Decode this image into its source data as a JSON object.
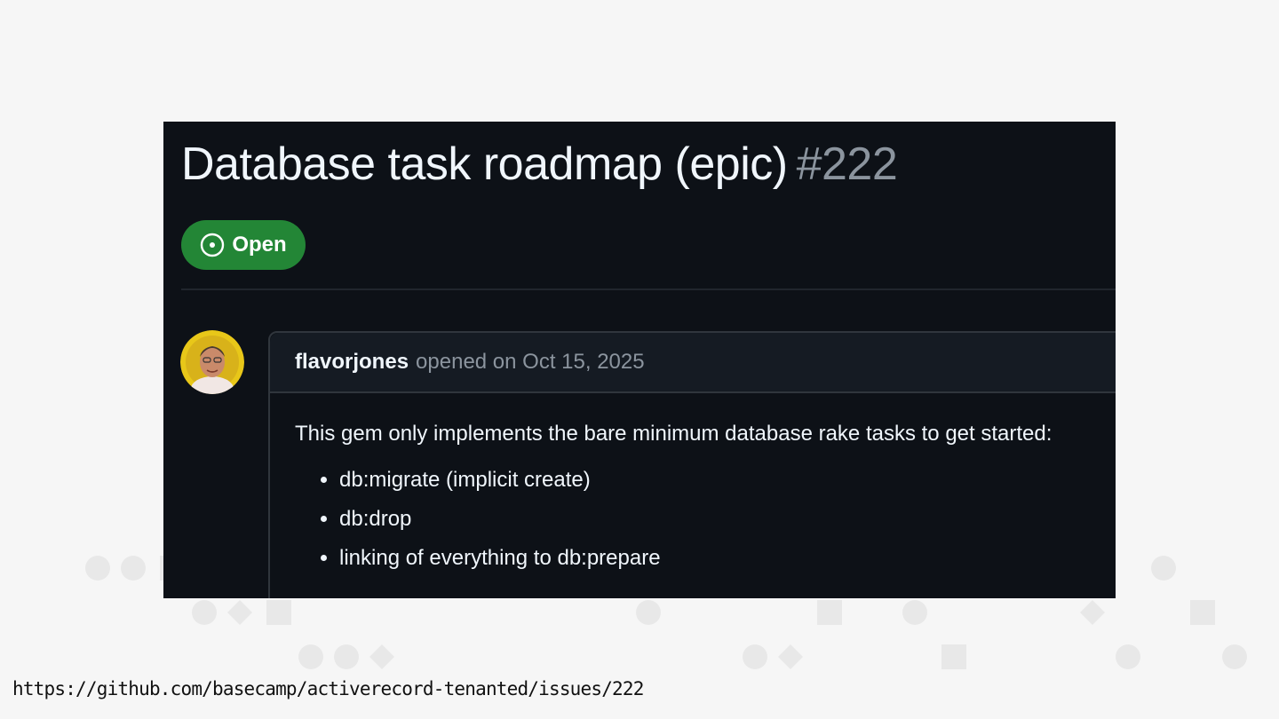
{
  "issue": {
    "title": "Database task roadmap (epic)",
    "number": "#222",
    "state_label": "Open",
    "state_icon": "issue-opened-icon",
    "state_color": "#238636"
  },
  "comment": {
    "author": "flavorjones",
    "meta": "opened on Oct 15, 2025",
    "intro": "This gem only implements the bare minimum database rake tasks to get started:",
    "items": [
      "db:migrate (implicit create)",
      "db:drop",
      "linking of everything to db:prepare"
    ]
  },
  "footer": {
    "url": "https://github.com/basecamp/activerecord-tenanted/issues/222"
  },
  "colors": {
    "background": "#f6f6f6",
    "panel": "#0d1117",
    "text": "#f0f6fc",
    "muted": "#8b949e",
    "border": "#30363d"
  }
}
